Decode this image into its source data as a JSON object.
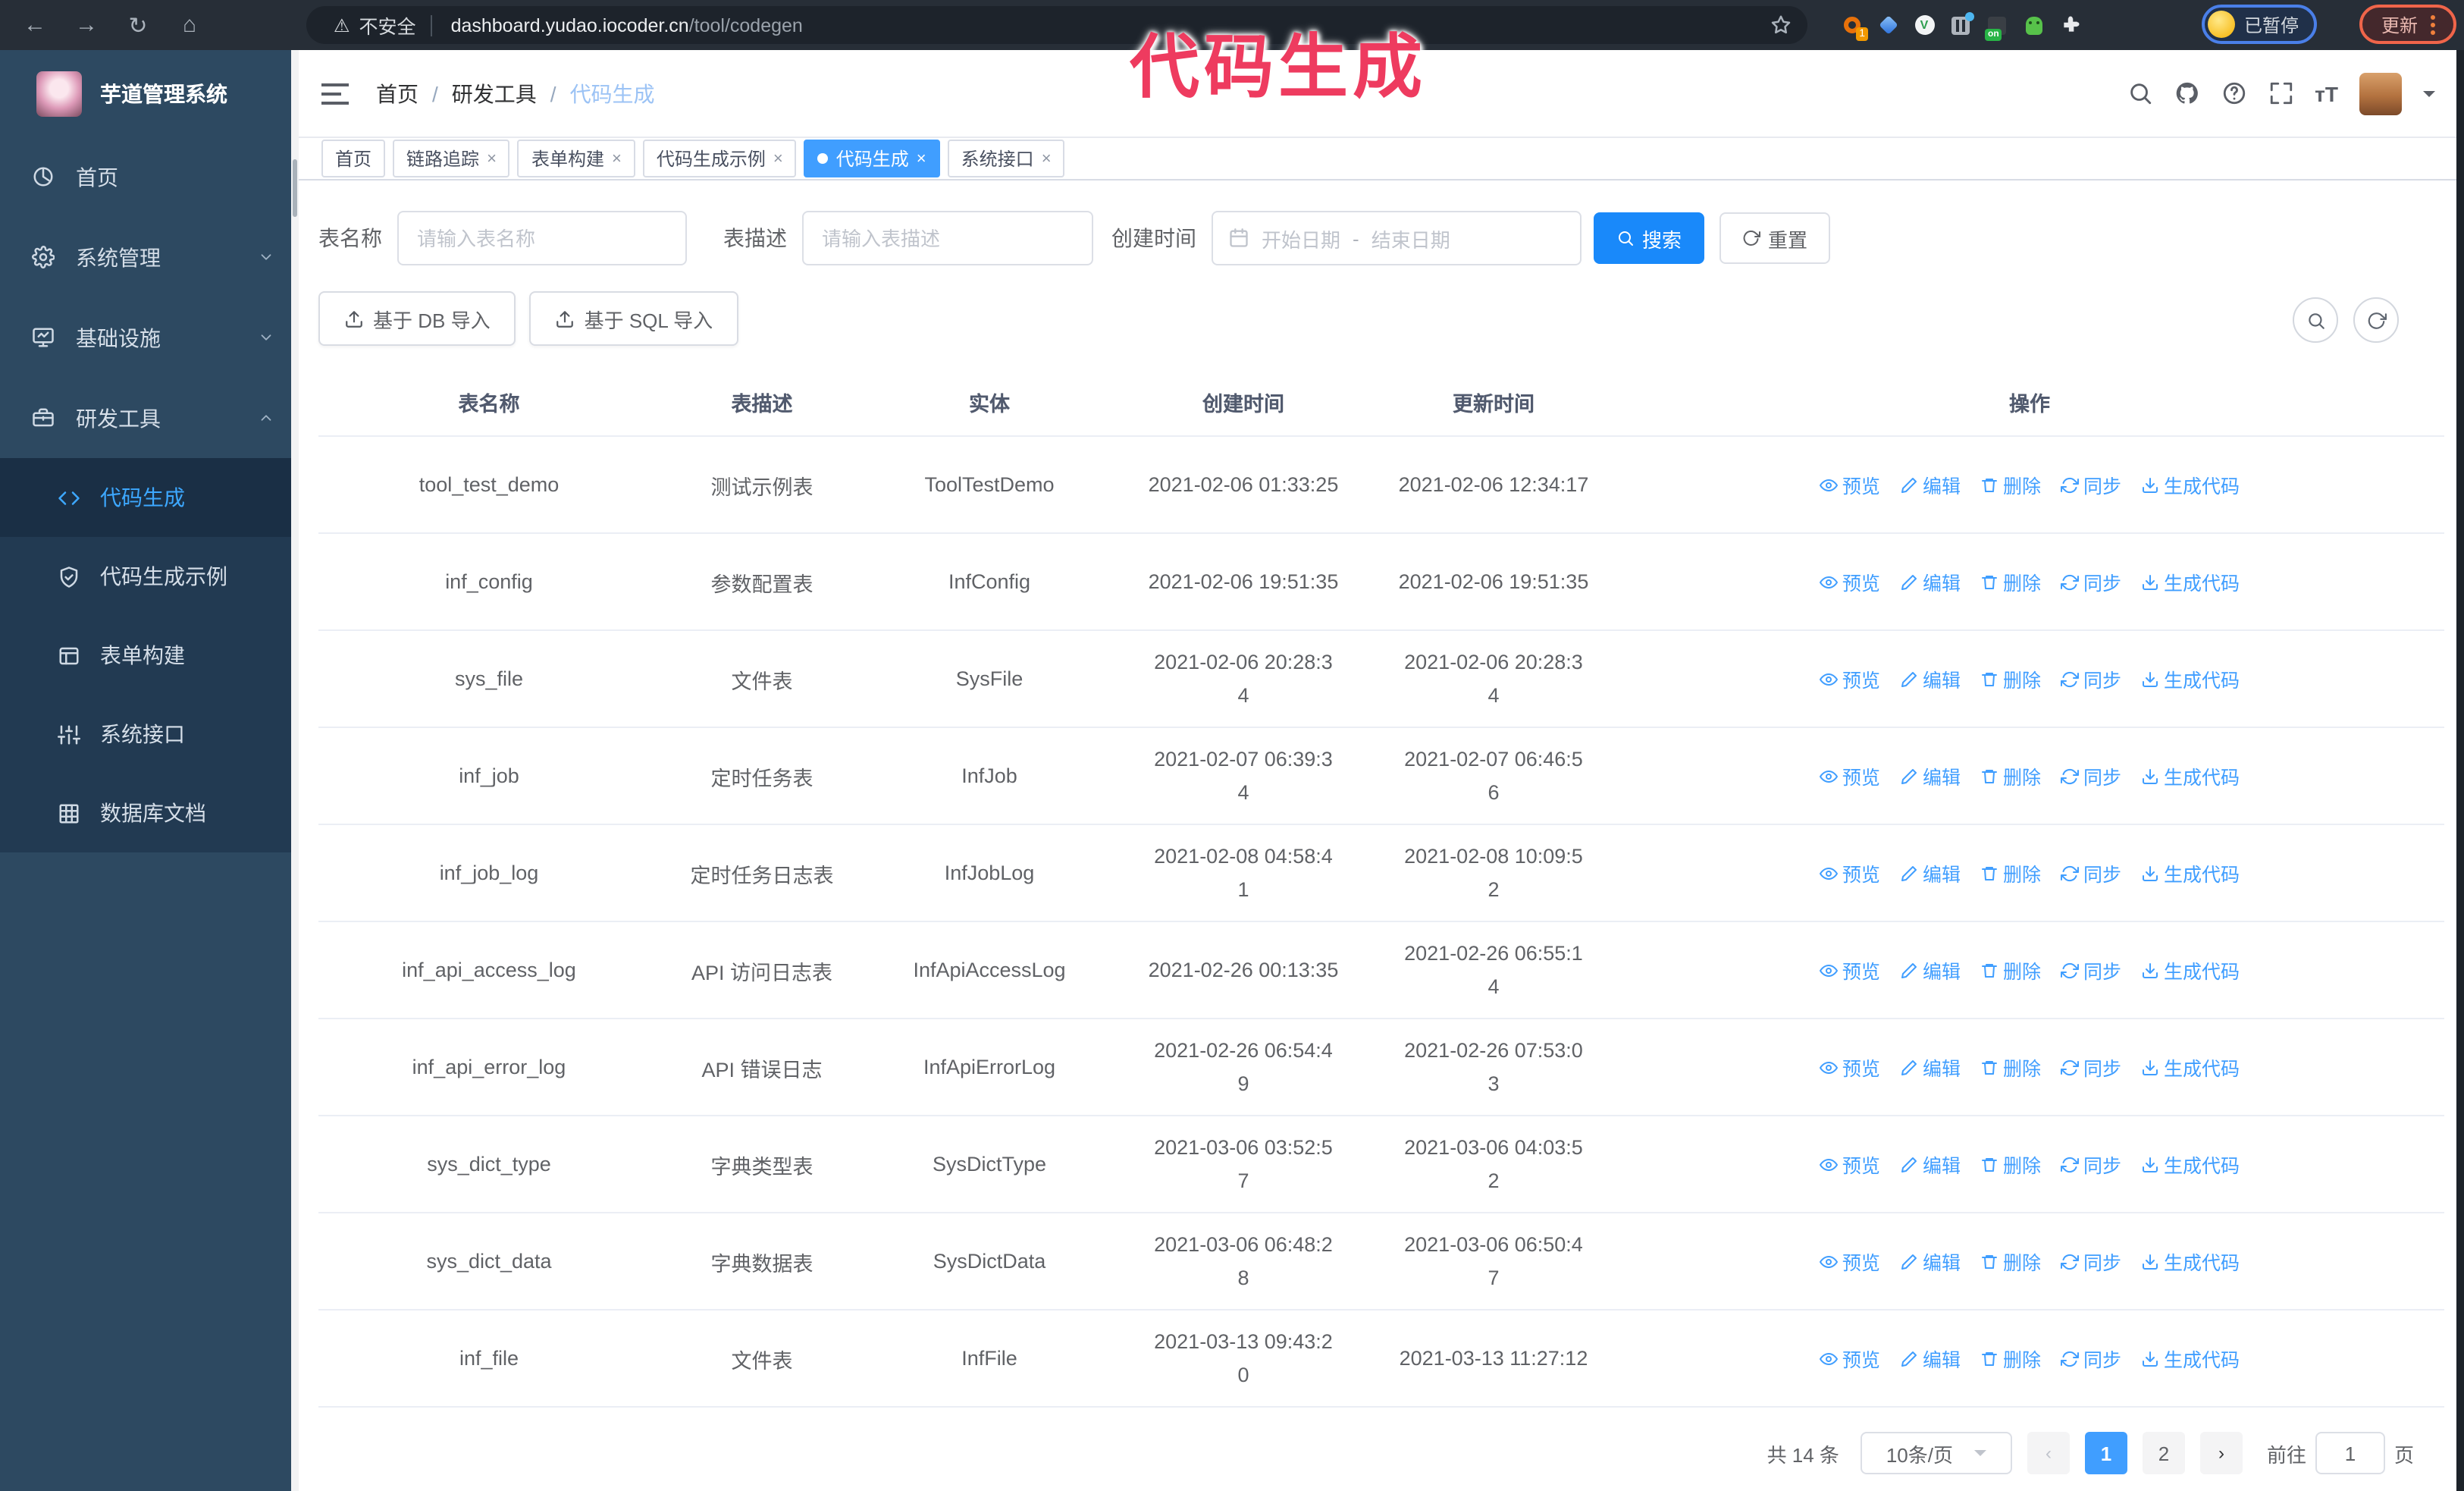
{
  "browser": {
    "security": "不安全",
    "url_host": "dashboard.yudao.iocoder.cn",
    "url_path": "/tool/codegen",
    "ext_badge": "1",
    "ext_check": "V",
    "ext_on": "on",
    "profile_status": "已暂停",
    "update_label": "更新"
  },
  "watermark": {
    "text": "代码生成",
    "color": "#ee3b5f"
  },
  "sidebar": {
    "title": "芋道管理系统",
    "items": [
      {
        "label": "首页",
        "icon": "dashboard-icon"
      },
      {
        "label": "系统管理",
        "icon": "gear-icon",
        "state": "collapsed"
      },
      {
        "label": "基础设施",
        "icon": "monitor-icon",
        "state": "collapsed"
      },
      {
        "label": "研发工具",
        "icon": "toolbox-icon",
        "state": "expanded"
      }
    ],
    "submenu": [
      {
        "label": "代码生成",
        "icon": "code-icon",
        "active": true
      },
      {
        "label": "代码生成示例",
        "icon": "shield-check-icon",
        "active": false
      },
      {
        "label": "表单构建",
        "icon": "form-icon",
        "active": false
      },
      {
        "label": "系统接口",
        "icon": "sliders-icon",
        "active": false
      },
      {
        "label": "数据库文档",
        "icon": "database-icon",
        "active": false
      }
    ]
  },
  "header": {
    "breadcrumb": [
      "首页",
      "研发工具",
      "代码生成"
    ],
    "icons": [
      "search-icon",
      "github-icon",
      "help-icon",
      "fullscreen-icon",
      "font-size-icon",
      "avatar",
      "caret-down-icon"
    ]
  },
  "tags": [
    {
      "label": "首页",
      "closable": false,
      "active": false
    },
    {
      "label": "链路追踪",
      "closable": true,
      "active": false
    },
    {
      "label": "表单构建",
      "closable": true,
      "active": false
    },
    {
      "label": "代码生成示例",
      "closable": true,
      "active": false
    },
    {
      "label": "代码生成",
      "closable": true,
      "active": true
    },
    {
      "label": "系统接口",
      "closable": true,
      "active": false
    }
  ],
  "filters": {
    "name_label": "表名称",
    "name_placeholder": "请输入表名称",
    "desc_label": "表描述",
    "desc_placeholder": "请输入表描述",
    "time_label": "创建时间",
    "start_placeholder": "开始日期",
    "range_separator": "-",
    "end_placeholder": "结束日期",
    "search_label": "搜索",
    "reset_label": "重置"
  },
  "toolbar": {
    "import_db_label": "基于 DB 导入",
    "import_sql_label": "基于 SQL 导入"
  },
  "table": {
    "columns": [
      "表名称",
      "表描述",
      "实体",
      "创建时间",
      "更新时间",
      "操作"
    ],
    "actions": {
      "preview": "预览",
      "edit": "编辑",
      "del": "删除",
      "sync": "同步",
      "gen": "生成代码"
    },
    "rows": [
      {
        "name": "tool_test_demo",
        "desc": "测试示例表",
        "entity": "ToolTestDemo",
        "created": "2021-02-06 01:33:25",
        "updated": "2021-02-06 12:34:17"
      },
      {
        "name": "inf_config",
        "desc": "参数配置表",
        "entity": "InfConfig",
        "created": "2021-02-06 19:51:35",
        "updated": "2021-02-06 19:51:35"
      },
      {
        "name": "sys_file",
        "desc": "文件表",
        "entity": "SysFile",
        "created": "2021-02-06 20:28:3\n4",
        "updated": "2021-02-06 20:28:3\n4"
      },
      {
        "name": "inf_job",
        "desc": "定时任务表",
        "entity": "InfJob",
        "created": "2021-02-07 06:39:3\n4",
        "updated": "2021-02-07 06:46:5\n6"
      },
      {
        "name": "inf_job_log",
        "desc": "定时任务日志表",
        "entity": "InfJobLog",
        "created": "2021-02-08 04:58:4\n1",
        "updated": "2021-02-08 10:09:5\n2"
      },
      {
        "name": "inf_api_access_log",
        "desc": "API 访问日志表",
        "entity": "InfApiAccessLog",
        "created": "2021-02-26 00:13:35",
        "updated": "2021-02-26 06:55:1\n4"
      },
      {
        "name": "inf_api_error_log",
        "desc": "API 错误日志",
        "entity": "InfApiErrorLog",
        "created": "2021-02-26 06:54:4\n9",
        "updated": "2021-02-26 07:53:0\n3"
      },
      {
        "name": "sys_dict_type",
        "desc": "字典类型表",
        "entity": "SysDictType",
        "created": "2021-03-06 03:52:5\n7",
        "updated": "2021-03-06 04:03:5\n2"
      },
      {
        "name": "sys_dict_data",
        "desc": "字典数据表",
        "entity": "SysDictData",
        "created": "2021-03-06 06:48:2\n8",
        "updated": "2021-03-06 06:50:4\n7"
      },
      {
        "name": "inf_file",
        "desc": "文件表",
        "entity": "InfFile",
        "created": "2021-03-13 09:43:2\n0",
        "updated": "2021-03-13 11:27:12"
      }
    ]
  },
  "pagination": {
    "total_text": "共 14 条",
    "page_size": "10条/页",
    "prev": "‹",
    "pages": [
      "1",
      "2"
    ],
    "current_page": "1",
    "next": "›",
    "goto_label": "前往",
    "goto_value": "1",
    "goto_unit": "页"
  },
  "colors": {
    "accent_blue": "#409eff",
    "search_button_blue": "#1989fa",
    "sidebar_bg": "#2d4961",
    "sidebar_submenu_bg": "#223a52",
    "chrome_bg": "#272e37",
    "watermark_pink": "#ee3b5f"
  }
}
